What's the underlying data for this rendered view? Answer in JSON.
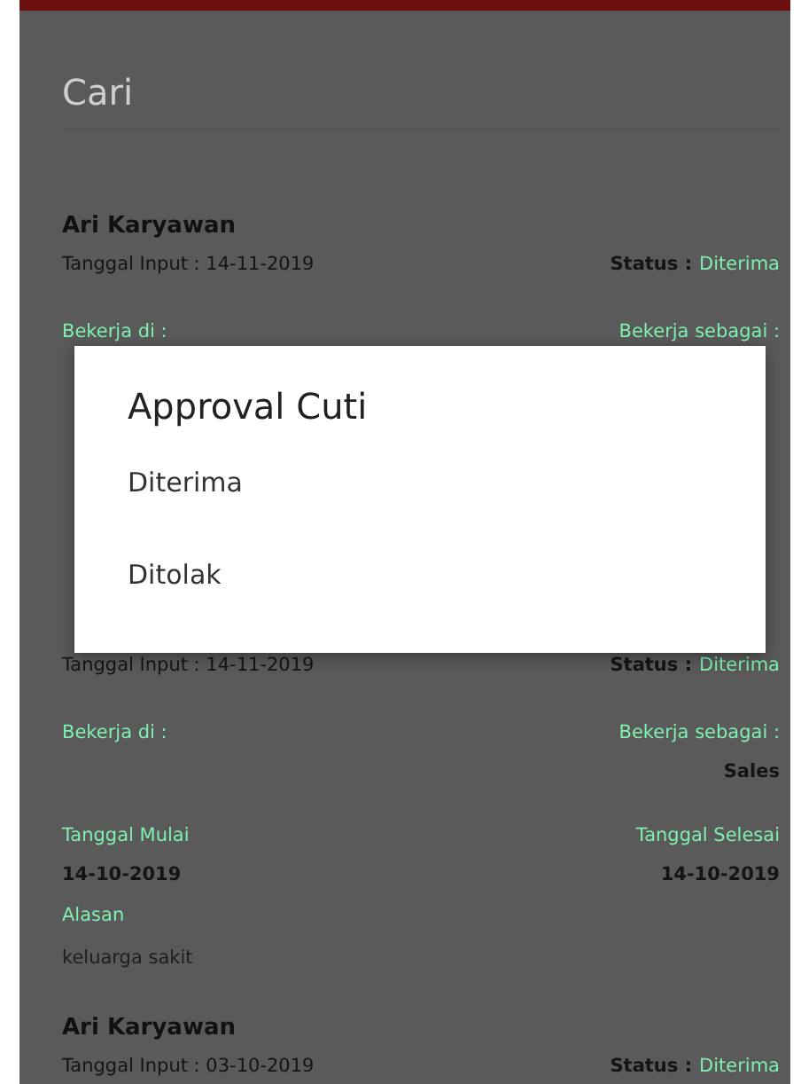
{
  "search": {
    "placeholder": "Cari"
  },
  "cards": [
    {
      "name": "Ari Karyawan",
      "input": "Tanggal Input : 14-11-2019",
      "status_label": "Status :",
      "status": "Diterima",
      "work_at_label": "Bekerja di :",
      "work_as_label": "Bekerja sebagai :"
    },
    {
      "input": "Tanggal Input : 14-11-2019",
      "status_label": "Status :",
      "status": "Diterima",
      "work_at_label": "Bekerja di :",
      "work_as_label": "Bekerja sebagai :",
      "work_as": "Sales",
      "start_label": "Tanggal Mulai",
      "end_label": "Tanggal Selesai",
      "start": "14-10-2019",
      "end": "14-10-2019",
      "reason_label": "Alasan",
      "reason": "keluarga sakit"
    },
    {
      "name": "Ari Karyawan",
      "input": "Tanggal Input : 03-10-2019",
      "status_label": "Status :",
      "status": "Diterima"
    }
  ],
  "dialog": {
    "title": "Approval Cuti",
    "options": [
      "Diterima",
      "Ditolak"
    ]
  }
}
